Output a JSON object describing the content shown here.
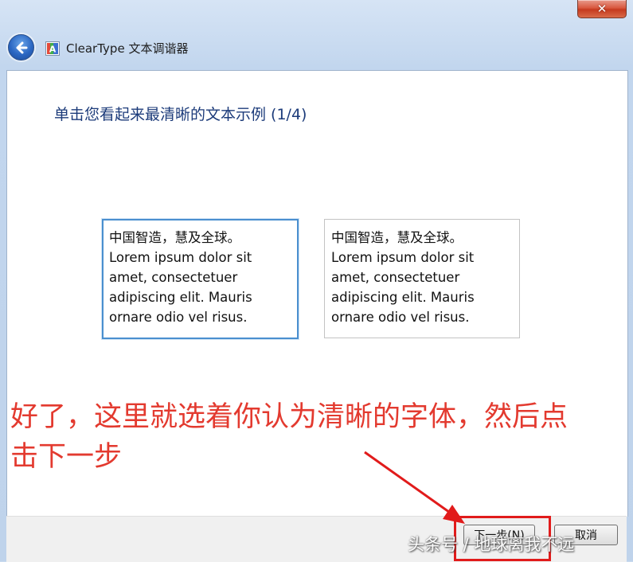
{
  "window": {
    "title": "ClearType 文本调谐器",
    "close_symbol": "✕",
    "back_icon": "back-arrow-icon",
    "app_icon": "cleartype-icon",
    "app_icon_letter": "A",
    "close_color": "#c53a1f",
    "accent": "#1c3b7a"
  },
  "page": {
    "heading": "单击您看起来最清晰的文本示例 (1/4)"
  },
  "samples": [
    {
      "lines": [
        "中国智造，慧及全球。",
        "Lorem ipsum dolor sit",
        "amet, consectetuer",
        "adipiscing elit. Mauris",
        "ornare odio vel risus."
      ],
      "selected": true
    },
    {
      "lines": [
        "中国智造，慧及全球。",
        "Lorem ipsum dolor sit",
        "amet, consectetuer",
        "adipiscing elit. Mauris",
        "ornare odio vel risus."
      ],
      "selected": false
    }
  ],
  "annotation": {
    "line1": "好了，这里就选着你认为清晰的字体，然后点",
    "line2": "击下一步",
    "color": "#e33a2f"
  },
  "footer": {
    "next_label": "下一步(N)",
    "cancel_label": "取消"
  },
  "watermark": "头条号 / 地球离我不远"
}
